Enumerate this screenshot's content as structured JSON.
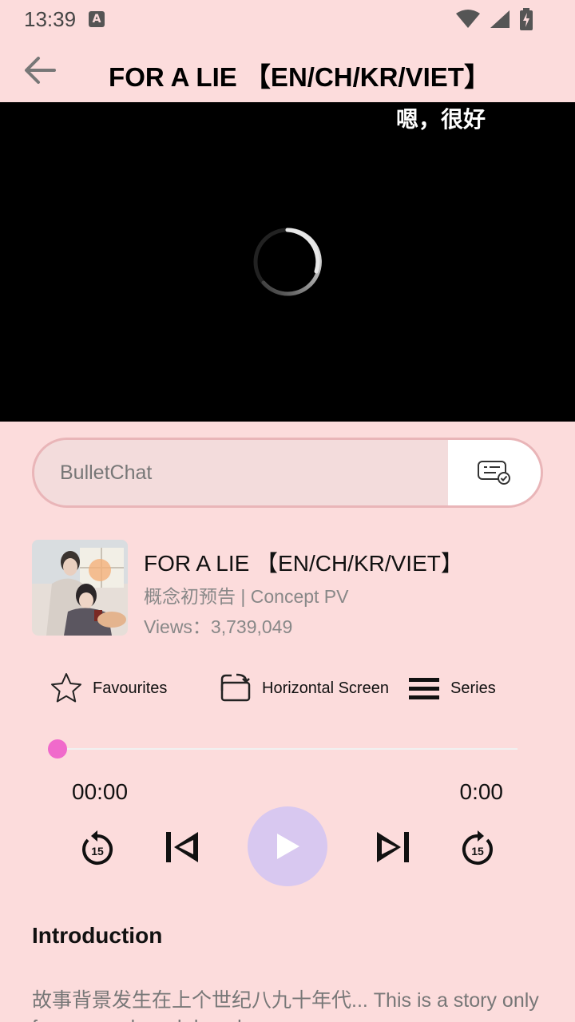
{
  "status": {
    "time": "13:39",
    "icons": [
      "keyboard-a-icon",
      "wifi-icon",
      "signal-icon",
      "battery-charging-icon"
    ]
  },
  "header": {
    "title": "FOR A LIE 【EN/CH/KR/VIET】",
    "back_icon": "arrow-left-icon"
  },
  "video": {
    "danmaku": "嗯，很好",
    "state": "loading"
  },
  "bullet_chat": {
    "placeholder": "BulletChat",
    "send_icon": "bullet-chat-send-icon"
  },
  "info": {
    "title": "FOR A LIE 【EN/CH/KR/VIET】",
    "subtitle": "概念初预告 | Concept PV",
    "views": "Views：3,739,049"
  },
  "actions": [
    {
      "label": "Favourites",
      "icon": "star-icon"
    },
    {
      "label": "Horizontal Screen",
      "icon": "rotate-screen-icon"
    },
    {
      "label": "Series",
      "icon": "list-icon"
    }
  ],
  "player": {
    "progress": 0,
    "current_time": "00:00",
    "total_time": "0:00",
    "rewind_label": "15",
    "forward_label": "15",
    "accent_color": "#f06acb",
    "play_color": "#d8c8f0"
  },
  "intro": {
    "title": "Introduction",
    "text": "故事背景发生在上个世纪八九十年代... This is a story only few remembered decades ago..."
  }
}
